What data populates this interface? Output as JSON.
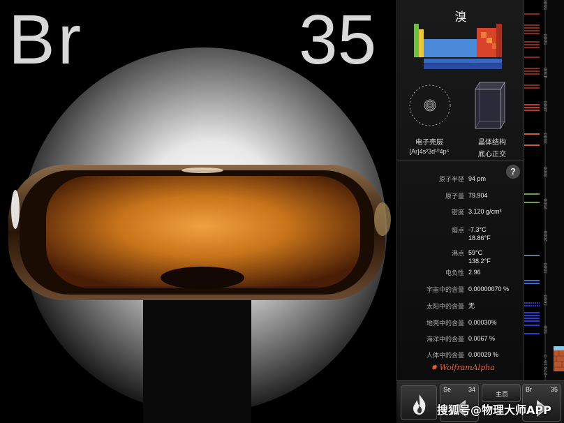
{
  "element": {
    "symbol": "Br",
    "number": "35",
    "name": "溴"
  },
  "structure": {
    "shell_label": "电子壳层",
    "shell_config": "[Ar]4s²3d¹⁰4p⁵",
    "crystal_label": "晶体结构",
    "crystal_value": "底心正交"
  },
  "help": "?",
  "properties": [
    {
      "key": "原子半径",
      "value": "94 pm"
    },
    {
      "key": "原子量",
      "value": "79.904"
    },
    {
      "key": "密度",
      "value": "3.120 g/cm³"
    },
    {
      "key": "熔点",
      "value": "-7.3°C",
      "value2": "18.86°F"
    },
    {
      "key": "沸点",
      "value": "59°C",
      "value2": "138.2°F"
    },
    {
      "key": "电负性",
      "value": "2.96"
    },
    {
      "key": "宇宙中的含量",
      "value": "0.00000070 %"
    },
    {
      "key": "太阳中的含量",
      "value": "无"
    },
    {
      "key": "地壳中的含量",
      "value": "0.00030%"
    },
    {
      "key": "海洋中的含量",
      "value": "0.0067 %"
    },
    {
      "key": "人体中的含量",
      "value": "0.00029 %"
    }
  ],
  "wolfram": "WolframAlpha",
  "spectrum": {
    "ticks": [
      "5500",
      "5000",
      "4500",
      "4000",
      "3500",
      "3000",
      "2500",
      "2000",
      "1500",
      "1000",
      "500",
      "0",
      "-273.15"
    ]
  },
  "nav": {
    "prev_symbol": "Se",
    "prev_number": "34",
    "home": "主页",
    "next_symbol": "Br",
    "next_number": "35"
  },
  "watermark": "搜狐号@物理大师APP",
  "colors": {
    "halogen": "#d8432a",
    "nonmetal": "#c8402a",
    "metal_blue": "#4a8ad8",
    "alkali_green": "#6cc040",
    "liquid": "#c8741a"
  }
}
